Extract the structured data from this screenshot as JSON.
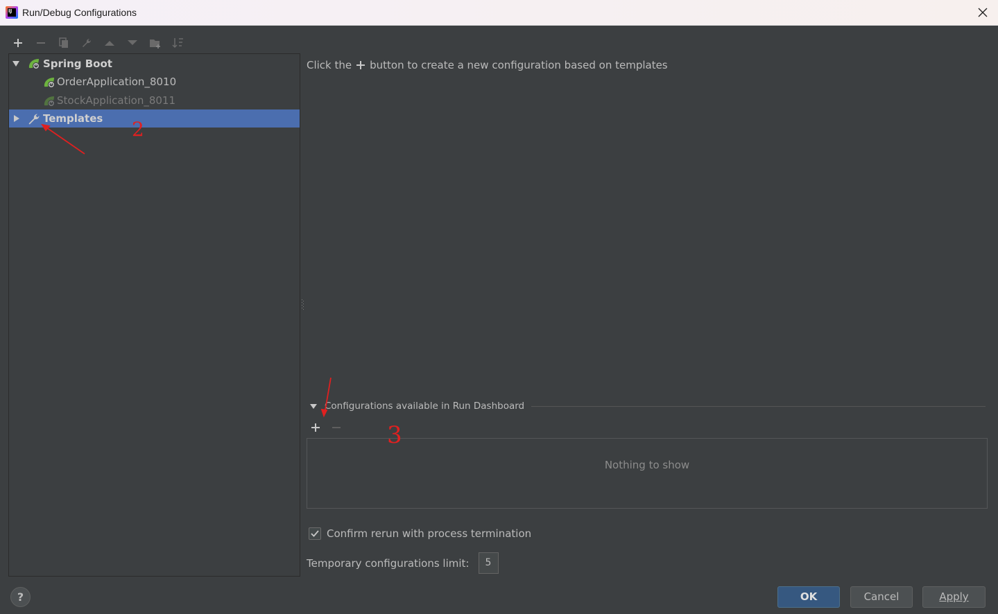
{
  "window": {
    "title": "Run/Debug Configurations"
  },
  "toolbar": {
    "buttons": [
      "add-icon",
      "remove-icon",
      "copy-icon",
      "wrench-icon",
      "move-up-icon",
      "move-down-icon",
      "folder-icon",
      "sort-icon"
    ]
  },
  "tree": {
    "items": [
      {
        "label": "Spring Boot",
        "expanded": true,
        "icon": "spring-boot-icon"
      },
      {
        "label": "OrderApplication_8010",
        "icon": "spring-app-icon"
      },
      {
        "label": "StockApplication_8011",
        "icon": "spring-app-icon",
        "dimmed": true
      },
      {
        "label": "Templates",
        "expanded": false,
        "selected": true,
        "icon": "wrench-icon"
      }
    ]
  },
  "main": {
    "hint_prefix": "Click the",
    "hint_suffix": "button to create a new configuration based on templates",
    "dashboard_title": "Configurations available in Run Dashboard",
    "empty_text": "Nothing to show",
    "confirm_rerun_label": "Confirm rerun with process termination",
    "confirm_rerun_checked": true,
    "temp_limit_label": "Temporary configurations limit:",
    "temp_limit_value": "5"
  },
  "buttons": {
    "ok": "OK",
    "cancel": "Cancel",
    "apply": "Apply",
    "help": "?"
  },
  "annotations": {
    "marker_2": "2",
    "marker_3": "3",
    "color": "#e02020"
  },
  "colors": {
    "selection": "#4b6eaf",
    "background": "#3c3f41",
    "ok_button": "#365880",
    "spring_green": "#6db33f"
  }
}
